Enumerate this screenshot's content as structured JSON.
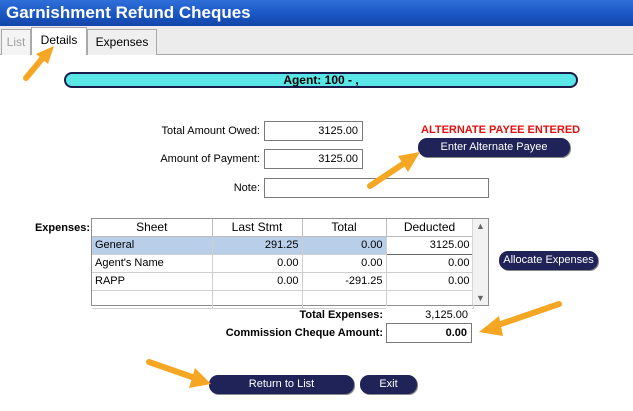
{
  "window": {
    "title": "Garnishment Refund Cheques"
  },
  "tabs": [
    {
      "label": "List"
    },
    {
      "label": "Details"
    },
    {
      "label": "Expenses"
    }
  ],
  "agent_bar": "Agent: 100 - ,",
  "form": {
    "total_owed_label": "Total Amount Owed:",
    "total_owed_value": "3125.00",
    "payment_label": "Amount of Payment:",
    "payment_value": "3125.00",
    "note_label": "Note:",
    "note_value": ""
  },
  "alternate_payee_status": "ALTERNATE PAYEE ENTERED",
  "buttons": {
    "enter_alternate_payee": "Enter Alternate Payee",
    "allocate_expenses": "Allocate Expenses",
    "return_to_list": "Return to List",
    "exit": "Exit"
  },
  "expenses": {
    "label": "Expenses:",
    "columns": [
      "Sheet",
      "Last Stmt",
      "Total",
      "Deducted"
    ],
    "rows": [
      {
        "sheet": "General",
        "last_stmt": "291.25",
        "total": "0.00",
        "deducted": "3125.00"
      },
      {
        "sheet": "Agent's Name",
        "last_stmt": "0.00",
        "total": "0.00",
        "deducted": "0.00"
      },
      {
        "sheet": "RAPP",
        "last_stmt": "0.00",
        "total": "-291.25",
        "deducted": "0.00"
      }
    ]
  },
  "totals": {
    "total_expenses_label": "Total Expenses:",
    "total_expenses_value": "3,125.00",
    "commission_label": "Commission Cheque Amount:",
    "commission_value": "0.00"
  },
  "colors": {
    "title_bar": "#1a56c4",
    "agent_bar": "#5ae6e6",
    "button": "#1f2358",
    "alert": "#e01010",
    "annotation_arrow": "#f5a623"
  }
}
